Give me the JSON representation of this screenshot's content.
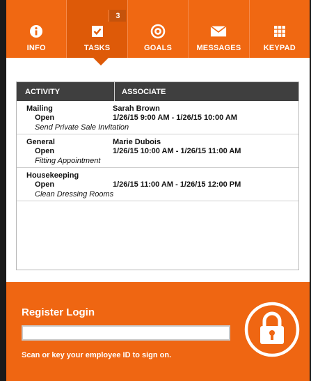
{
  "nav": {
    "items": [
      {
        "id": "info",
        "label": "INFO",
        "icon": "info-icon"
      },
      {
        "id": "tasks",
        "label": "TASKS",
        "icon": "check-icon",
        "badge": "3",
        "active": true
      },
      {
        "id": "goals",
        "label": "GOALS",
        "icon": "target-icon"
      },
      {
        "id": "messages",
        "label": "MESSAGES",
        "icon": "envelope-icon"
      },
      {
        "id": "keypad",
        "label": "KEYPAD",
        "icon": "keypad-icon"
      }
    ]
  },
  "table": {
    "headers": [
      "ACTIVITY",
      "ASSOCIATE"
    ],
    "rows": [
      {
        "activity": "Mailing",
        "associate": "Sarah Brown",
        "status": "Open",
        "time": "1/26/15 9:00 AM - 1/26/15 10:00 AM",
        "description": "Send Private Sale Invitation"
      },
      {
        "activity": "General",
        "associate": "Marie Dubois",
        "status": "Open",
        "time": "1/26/15 10:00 AM - 1/26/15 11:00 AM",
        "description": "Fitting Appointment"
      },
      {
        "activity": "Housekeeping",
        "associate": "",
        "status": "Open",
        "time": "1/26/15 11:00 AM - 1/26/15 12:00 PM",
        "description": "Clean Dressing Rooms"
      }
    ]
  },
  "register": {
    "title": "Register Login",
    "input_value": "",
    "hint": "Scan or key your employee ID to sign on.",
    "icon": "lock-icon"
  },
  "colors": {
    "accent": "#f06812",
    "active": "#de5a08",
    "header": "#3f3f3f"
  }
}
